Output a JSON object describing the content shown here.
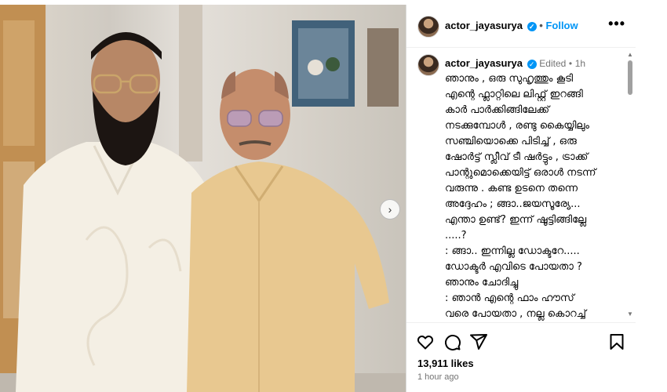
{
  "post": {
    "username": "actor_jayasurya",
    "follow_separator": "•",
    "follow_label": "Follow",
    "more_label": "•••",
    "verified_mark": "✓",
    "edited_label": "Edited",
    "separator": "•",
    "edited_time": "1h",
    "caption": "ഞാനും , ഒരു സുഹൃത്തും കൂടി\nഎന്റെ ഫ്ലാറ്റിലെ ലിഫ്റ്റ് ഇറങ്ങി\nകാർ പാർക്കിങ്ങിലേക്ക്\nനടക്കുമ്പോൾ , രണ്ടു കൈയ്യിലും\nസഞ്ചിയൊക്കെ പിടിച്ച് , ഒരു\nഷോർട്ട് സ്ലീവ് ടീ ഷർട്ടും , ട്രാക്ക്\nപാന്റുമൊക്കെയിട്ട് ഒരാൾ നടന്ന്\nവരുന്നു . കണ്ട ഉടനെ തന്നെ\nഅദ്ദേഹം ; ങ്ങാ..ജയസൂര്യേ...\nഎന്താ ഉണ്ട്? ഇന്ന് ഷൂട്ടിങ്ങില്ലേ\n.....?\n: ങ്ങാ.. ഇന്നില്ല ഡോക്ടറേ.....\nഡോക്ടർ എവിടെ പോയതാ ?\nഞാനും ചോദിച്ചു\n: ഞാൻ എന്റെ ഫാം ഹൗസ്\nവരെ പോയതാ , നല്ല കൊറച്ച്\nറമ്പൂട്ടാനുണ്ട് ഞാൻ ജെയ്സിയോട്\nപറഞ്ഞേക്കാം സരിതയുടെ\nകൈയിൽ കൊറച്ച്\nകൊടുത്തേക്കാൻ\n: ഓ താങ്കു ഡോക്ടർ അപ്പോ",
    "likes": "13,911 likes",
    "time_ago": "1 hour ago",
    "carousel_next": "›",
    "scroll_up": "▲",
    "scroll_down": "▼"
  },
  "icons": {
    "like": "heart-icon",
    "comment": "comment-icon",
    "share": "share-icon",
    "save": "bookmark-icon",
    "next": "chevron-right-icon"
  },
  "colors": {
    "link": "#0095f6",
    "muted": "#737373",
    "border": "#dbdbdb"
  }
}
